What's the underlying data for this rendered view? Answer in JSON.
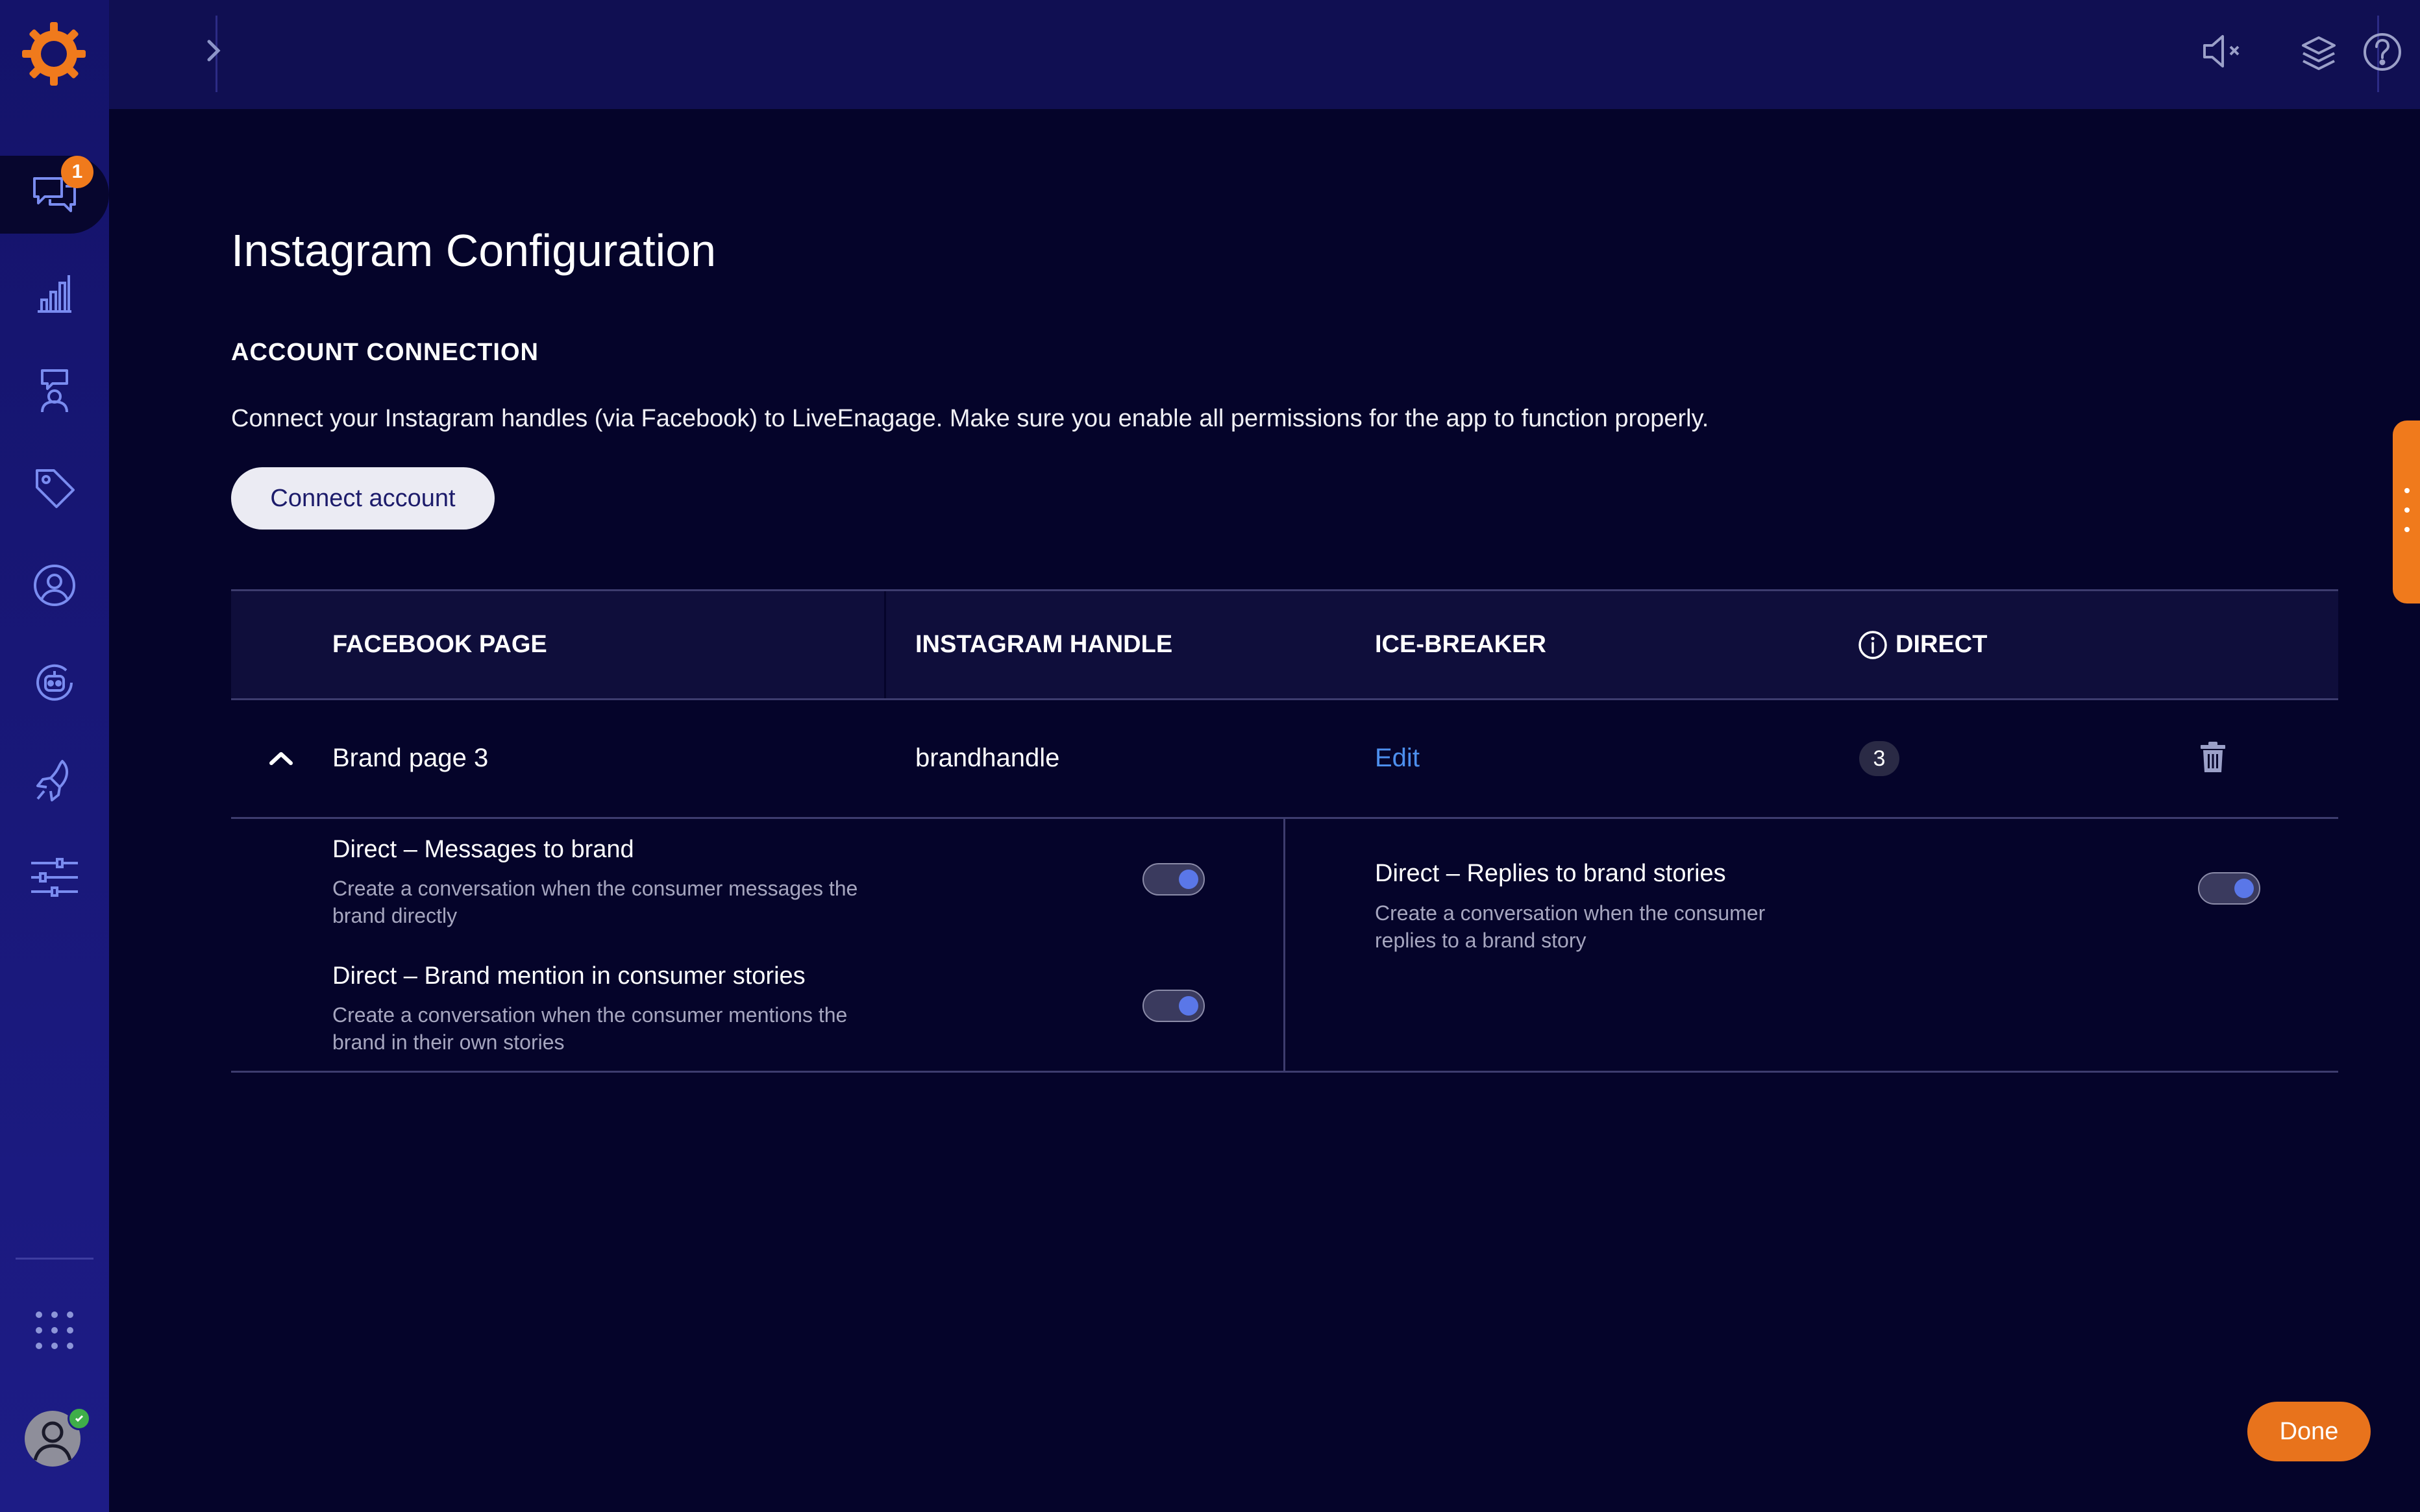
{
  "sidebar": {
    "logo": "liveperson-logo",
    "items": [
      {
        "name": "conversations",
        "icon": "chat-bubbles-icon",
        "badge": "1",
        "active": true
      },
      {
        "name": "analytics",
        "icon": "bar-chart-icon"
      },
      {
        "name": "agents",
        "icon": "agent-chat-icon"
      },
      {
        "name": "tags",
        "icon": "tag-icon"
      },
      {
        "name": "users",
        "icon": "user-circle-icon"
      },
      {
        "name": "bots",
        "icon": "bot-icon"
      },
      {
        "name": "automation",
        "icon": "rocket-icon"
      },
      {
        "name": "settings",
        "icon": "sliders-icon"
      }
    ],
    "apps_icon": "grid-dots-icon",
    "user_status": "online"
  },
  "topbar": {
    "expand_icon": "chevron-right-icon",
    "mute_icon": "speaker-muted-icon",
    "layers_icon": "layers-icon",
    "help_icon": "help-circle-icon"
  },
  "page": {
    "title": "Instagram Configuration",
    "section_heading": "ACCOUNT CONNECTION",
    "description": "Connect your Instagram handles (via Facebook) to LiveEnagage. Make sure you enable all permissions for the app to function properly.",
    "connect_button": "Connect account"
  },
  "table": {
    "headers": {
      "facebook_page": "FACEBOOK PAGE",
      "instagram_handle": "INSTAGRAM HANDLE",
      "ice_breaker": "ICE-BREAKER",
      "direct": "DIRECT"
    },
    "row": {
      "facebook_page": "Brand page 3",
      "instagram_handle": "brandhandle",
      "ice_breaker_link": "Edit",
      "direct_count": "3",
      "expanded": true
    },
    "options": [
      {
        "title": "Direct – Messages to brand",
        "description": "Create a conversation when the consumer messages the brand directly",
        "enabled": true
      },
      {
        "title": "Direct – Brand mention in consumer stories",
        "description": "Create a conversation when the consumer mentions the brand in their own stories",
        "enabled": true
      },
      {
        "title": "Direct – Replies to brand stories",
        "description": "Create a conversation when the consumer replies to a brand story",
        "enabled": true
      }
    ]
  },
  "footer": {
    "done_button": "Done"
  },
  "colors": {
    "background": "#05042a",
    "sidebar": "#1d1c86",
    "accent_orange": "#f07a1c",
    "link_blue": "#4d8fee",
    "toggle_on": "#5a77e8"
  }
}
